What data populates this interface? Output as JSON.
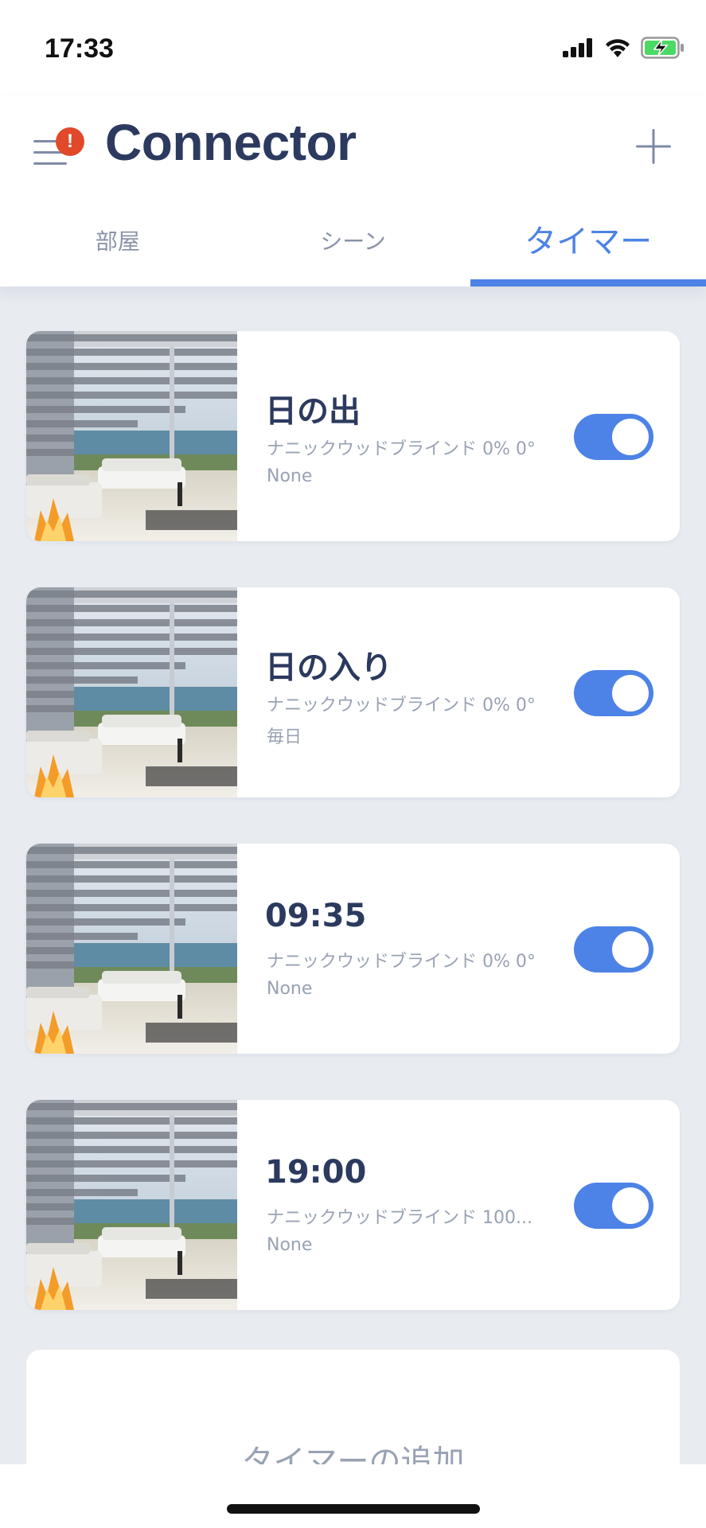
{
  "status": {
    "time": "17:33"
  },
  "header": {
    "title": "Connector"
  },
  "tabs": [
    {
      "label": "部屋",
      "active": false
    },
    {
      "label": "シーン",
      "active": false
    },
    {
      "label": "タイマー",
      "active": true
    }
  ],
  "timers": [
    {
      "title": "日の出",
      "device": "ナニックウッドブラインド 0% 0°",
      "repeat": "None",
      "enabled": true
    },
    {
      "title": "日の入り",
      "device": "ナニックウッドブラインド 0% 0°",
      "repeat": "毎日",
      "enabled": true
    },
    {
      "title": "09:35",
      "device": "ナニックウッドブラインド 0% 0°",
      "repeat": "None",
      "enabled": true
    },
    {
      "title": "19:00",
      "device": "ナニックウッドブラインド 100...",
      "repeat": "None",
      "enabled": true
    }
  ],
  "add_timer": {
    "label": "タイマーの追加"
  },
  "colors": {
    "accent": "#4d82e6",
    "title": "#2b3a5e",
    "badge": "#e0492a",
    "background": "#e8ebf0"
  }
}
